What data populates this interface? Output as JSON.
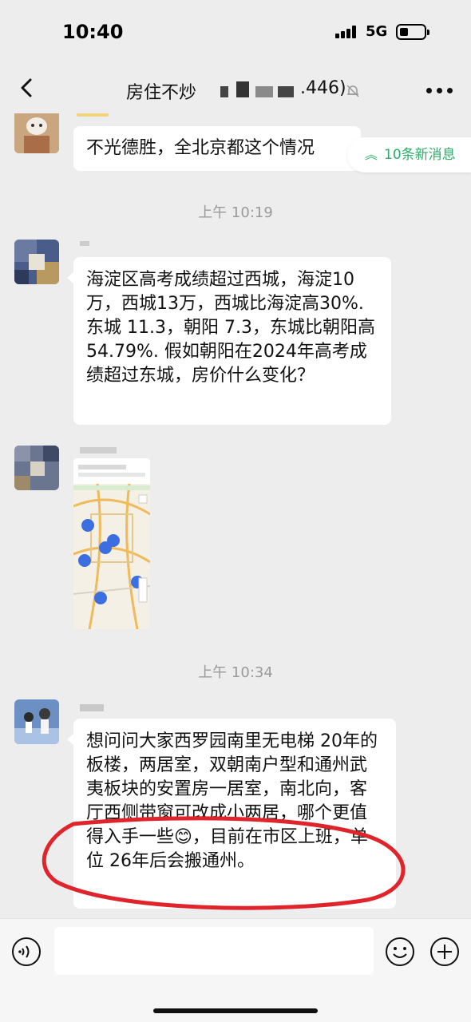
{
  "status_bar": {
    "time": "10:40",
    "network": "5G"
  },
  "header": {
    "title_prefix": "房住不炒",
    "title_suffix": ".446)"
  },
  "new_messages": {
    "label": "10条新消息"
  },
  "messages": [
    {
      "type": "text",
      "text": "不光德胜，全北京都这个情况"
    },
    {
      "type": "timestamp",
      "text": "上午 10:19"
    },
    {
      "type": "text",
      "text": "海淀区高考成绩超过西城，海淀10万，西城13万，西城比海淀高30%. 东城 11.3，朝阳 7.3，东城比朝阳高 54.79%. 假如朝阳在2024年高考成绩超过东城，房价什么变化？"
    },
    {
      "type": "image",
      "description_icon": "map-screenshot"
    },
    {
      "type": "timestamp",
      "text": "上午 10:34"
    },
    {
      "type": "text",
      "text": "想问问大家西罗园南里无电梯 20年的板楼，两居室，双朝南户型和通州武夷板块的安置房一居室，南北向，客厅西侧带窗可改成小两居，哪个更值得入手一些😊，目前在市区上班，单位 26年后会搬通州。"
    }
  ],
  "annotation": {
    "color": "#e0242b"
  },
  "colors": {
    "accent_green": "#2aae67",
    "bg": "#ededed"
  },
  "map_pins": [
    "",
    "",
    "",
    "",
    "",
    ""
  ]
}
